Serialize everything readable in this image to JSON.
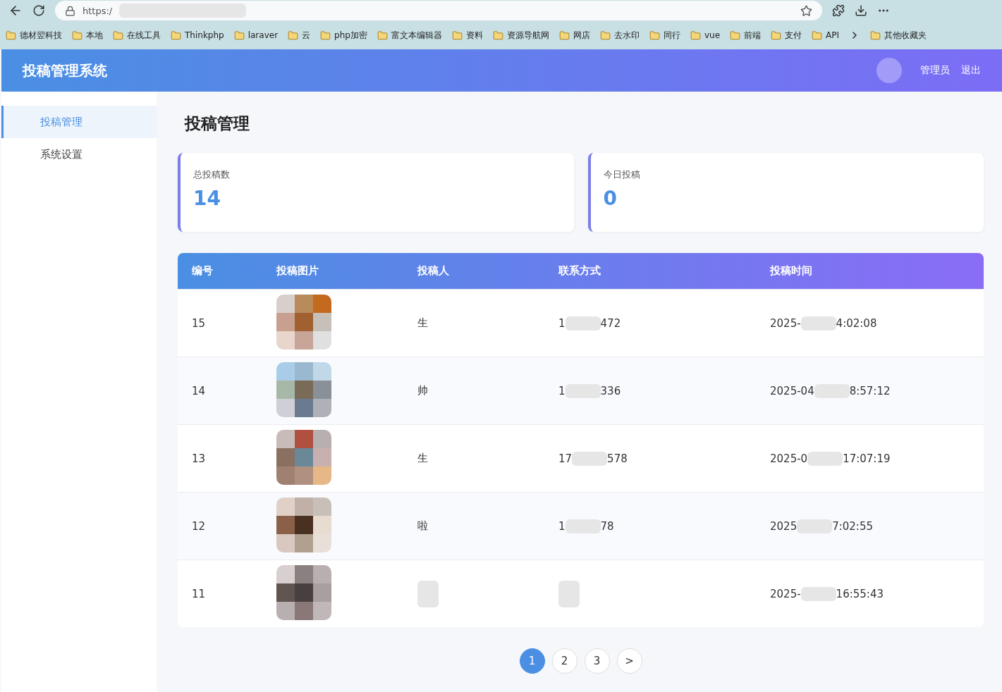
{
  "browser": {
    "address": "https:/",
    "bookmarks": [
      "德材翌科技",
      "本地",
      "在线工具",
      "Thinkphp",
      "laraver",
      "云",
      "php加密",
      "富文本编辑器",
      "资料",
      "资源导航网",
      "网店",
      "去水印",
      "同行",
      "vue",
      "前端",
      "支付",
      "API"
    ],
    "more_bookmarks": "其他收藏夹"
  },
  "app": {
    "title": "投稿管理系统",
    "user": "管理员",
    "logout": "退出"
  },
  "sidebar": {
    "items": [
      {
        "label": "投稿管理",
        "selected": true
      },
      {
        "label": "系统设置",
        "selected": false
      }
    ]
  },
  "page_title": "投稿管理",
  "stats": [
    {
      "label": "总投稿数",
      "value": "14"
    },
    {
      "label": "今日投稿",
      "value": "0"
    }
  ],
  "table": {
    "columns": [
      "编号",
      "投稿图片",
      "投稿人",
      "联系方式",
      "投稿时间"
    ],
    "rows": [
      {
        "id": "15",
        "image": {
          "kind": "picture"
        },
        "name": [
          "生"
        ],
        "phone": [
          "1",
          "472"
        ],
        "time": [
          "2025-",
          "4:02:08"
        ]
      },
      {
        "id": "14",
        "image": {
          "kind": "picture"
        },
        "name": [
          "帅"
        ],
        "phone": [
          "1",
          "336"
        ],
        "time": [
          "2025-04",
          "8:57:12"
        ]
      },
      {
        "id": "13",
        "image": {
          "kind": "picture"
        },
        "name": [
          "生"
        ],
        "phone": [
          "17",
          "578"
        ],
        "time": [
          "2025-0",
          "17:07:19"
        ]
      },
      {
        "id": "12",
        "image": {
          "kind": "picture"
        },
        "name": [
          "啦"
        ],
        "phone": [
          "1",
          "78"
        ],
        "time": [
          "2025",
          "7:02:55"
        ]
      },
      {
        "id": "11",
        "image": {
          "kind": "picture"
        },
        "time": [
          "2025-",
          "16:55:43"
        ]
      }
    ]
  },
  "pagination": [
    {
      "label": "1",
      "selected": true
    },
    {
      "label": "2",
      "selected": false
    },
    {
      "label": "3",
      "selected": false
    },
    {
      "label": ">",
      "selected": false
    }
  ]
}
